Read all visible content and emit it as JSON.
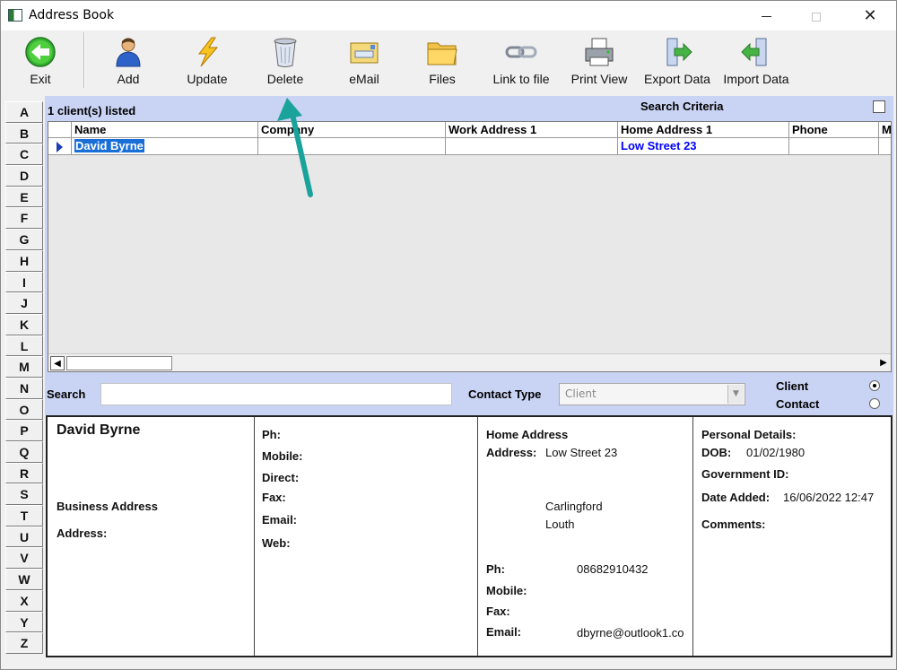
{
  "window": {
    "title": "Address Book"
  },
  "toolbar": {
    "buttons": [
      "Exit",
      "Add",
      "Update",
      "Delete",
      "eMail",
      "Files",
      "Link to file",
      "Print View",
      "Export Data",
      "Import Data"
    ]
  },
  "letters": [
    "A",
    "B",
    "C",
    "D",
    "E",
    "F",
    "G",
    "H",
    "I",
    "J",
    "K",
    "L",
    "M",
    "N",
    "O",
    "P",
    "Q",
    "R",
    "S",
    "T",
    "U",
    "V",
    "W",
    "X",
    "Y",
    "Z"
  ],
  "list": {
    "count_label": "1 client(s) listed",
    "search_criteria_label": "Search Criteria",
    "columns": [
      "Name",
      "Company",
      "Work Address 1",
      "Home Address 1",
      "Phone",
      "M"
    ],
    "rows": [
      {
        "name": "David  Byrne",
        "company": "",
        "work_address": "",
        "home_address": "Low Street 23",
        "phone": ""
      }
    ]
  },
  "search": {
    "label": "Search",
    "value": "",
    "contact_type_label": "Contact Type",
    "contact_type_value": "Client",
    "radio_client": "Client",
    "radio_contact": "Contact",
    "selected": "Client"
  },
  "details": {
    "name": "David  Byrne",
    "business_address_label": "Business Address",
    "address_label": "Address:",
    "ph_label": "Ph:",
    "mobile_label": "Mobile:",
    "direct_label": "Direct:",
    "fax_label": "Fax:",
    "email_label": "Email:",
    "web_label": "Web:",
    "home_address_label": "Home Address",
    "home_address_field": "Address:",
    "home_address_line1": "Low Street 23",
    "home_address_town": "Carlingford",
    "home_address_county": "Louth",
    "home_ph_label": "Ph:",
    "home_ph": "08682910432",
    "home_mobile_label": "Mobile:",
    "home_fax_label": "Fax:",
    "home_email_label": "Email:",
    "home_email": "dbyrne@outlook1.co",
    "personal_details_label": "Personal Details:",
    "dob_label": "DOB:",
    "dob": "01/02/1980",
    "gov_id_label": "Government ID:",
    "date_added_label": "Date Added:",
    "date_added": "16/06/2022 12:47",
    "comments_label": "Comments:"
  },
  "colors": {
    "panel": "#c9d3f3",
    "selection": "#1a6fd6",
    "link_blue": "#0000ff",
    "annotation_arrow": "#1aa39a"
  }
}
